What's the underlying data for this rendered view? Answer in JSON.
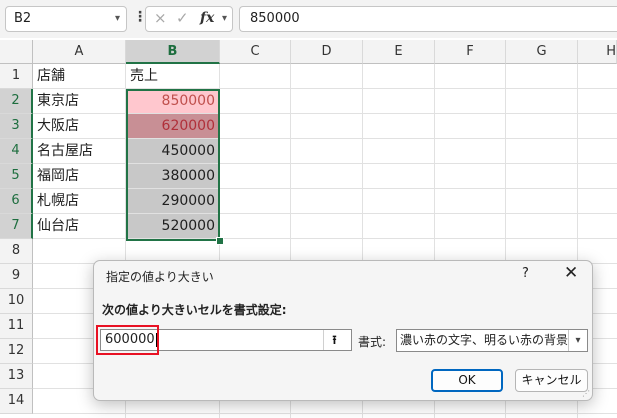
{
  "formula_bar": {
    "name_box": "B2",
    "cancel_icon": "×",
    "enter_icon": "✓",
    "fx_label": "fx",
    "formula_value": "850000"
  },
  "columns": [
    "A",
    "B",
    "C",
    "D",
    "E",
    "F",
    "G",
    "H"
  ],
  "rows": [
    "1",
    "2",
    "3",
    "4",
    "5",
    "6",
    "7",
    "8",
    "9",
    "10",
    "11",
    "12",
    "13",
    "14"
  ],
  "sheet": {
    "header": {
      "a": "店舗",
      "b": "売上"
    },
    "data": [
      {
        "store": "東京店",
        "sales": "850000",
        "highlight": "light"
      },
      {
        "store": "大阪店",
        "sales": "620000",
        "highlight": "dark"
      },
      {
        "store": "名古屋店",
        "sales": "450000",
        "highlight": "none"
      },
      {
        "store": "福岡店",
        "sales": "380000",
        "highlight": "none"
      },
      {
        "store": "札幌店",
        "sales": "290000",
        "highlight": "none"
      },
      {
        "store": "仙台店",
        "sales": "520000",
        "highlight": "none"
      }
    ]
  },
  "dialog": {
    "title": "指定の値より大きい",
    "help": "?",
    "close": "✕",
    "prompt": "次の値より大きいセルを書式設定:",
    "value": "600000",
    "collapse_icon": "⭱",
    "format_label": "書式:",
    "format_value": "濃い赤の文字、明るい赤の背景",
    "ok_label": "OK",
    "cancel_label": "キャンセル"
  },
  "colors": {
    "selection": "#217346",
    "highlight_fill": "#ffc7ce",
    "highlight_text": "#9c0006",
    "callout": "#e81123"
  }
}
